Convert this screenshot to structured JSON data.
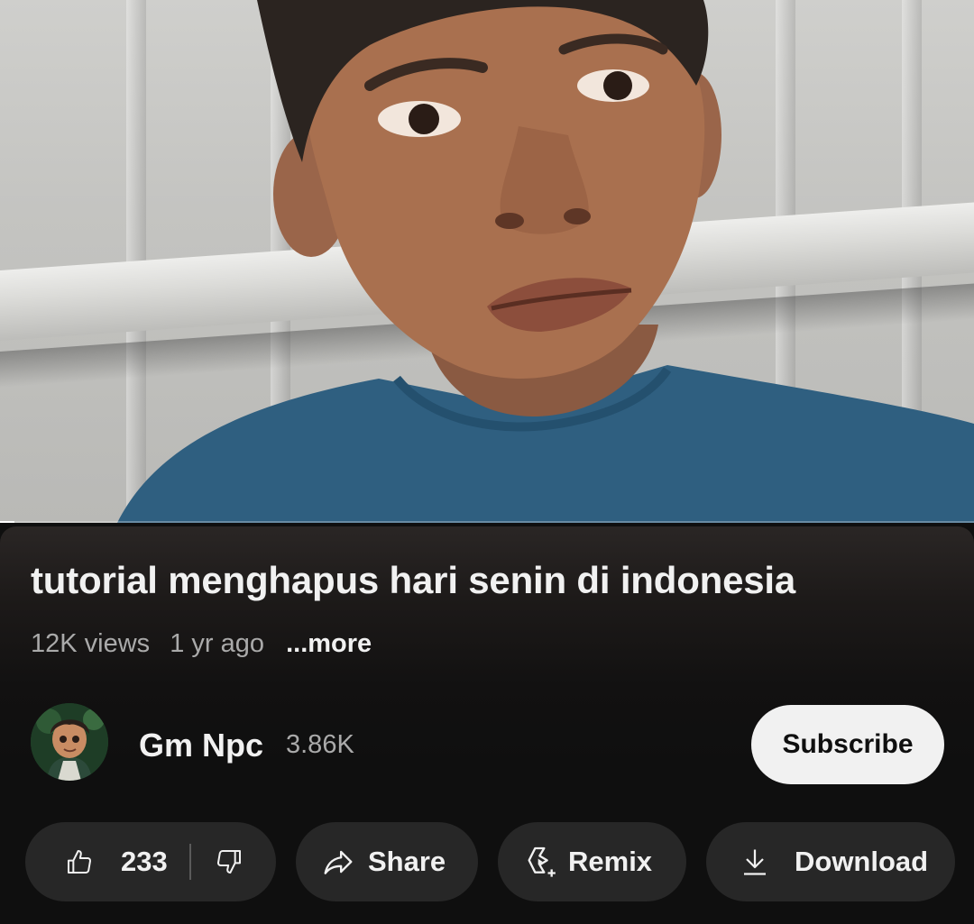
{
  "video": {
    "title": "tutorial menghapus hari senin di indonesia",
    "views": "12K views",
    "age": "1 yr ago",
    "more_label": "...more",
    "progress_fraction": 0.015
  },
  "channel": {
    "name": "Gm Npc",
    "subscribers": "3.86K",
    "subscribe_label": "Subscribe"
  },
  "actions": {
    "like_count": "233",
    "share_label": "Share",
    "remix_label": "Remix",
    "download_label": "Download"
  },
  "icons": [
    "thumbs-up-icon",
    "thumbs-down-icon",
    "share-arrow-icon",
    "remix-icon",
    "download-icon"
  ],
  "colors": {
    "background": "#0f0f0f",
    "pill": "#272727",
    "text_primary": "#f1f1f1",
    "text_secondary": "#aaaaaa",
    "subscribe_bg": "#f1f1f1"
  }
}
